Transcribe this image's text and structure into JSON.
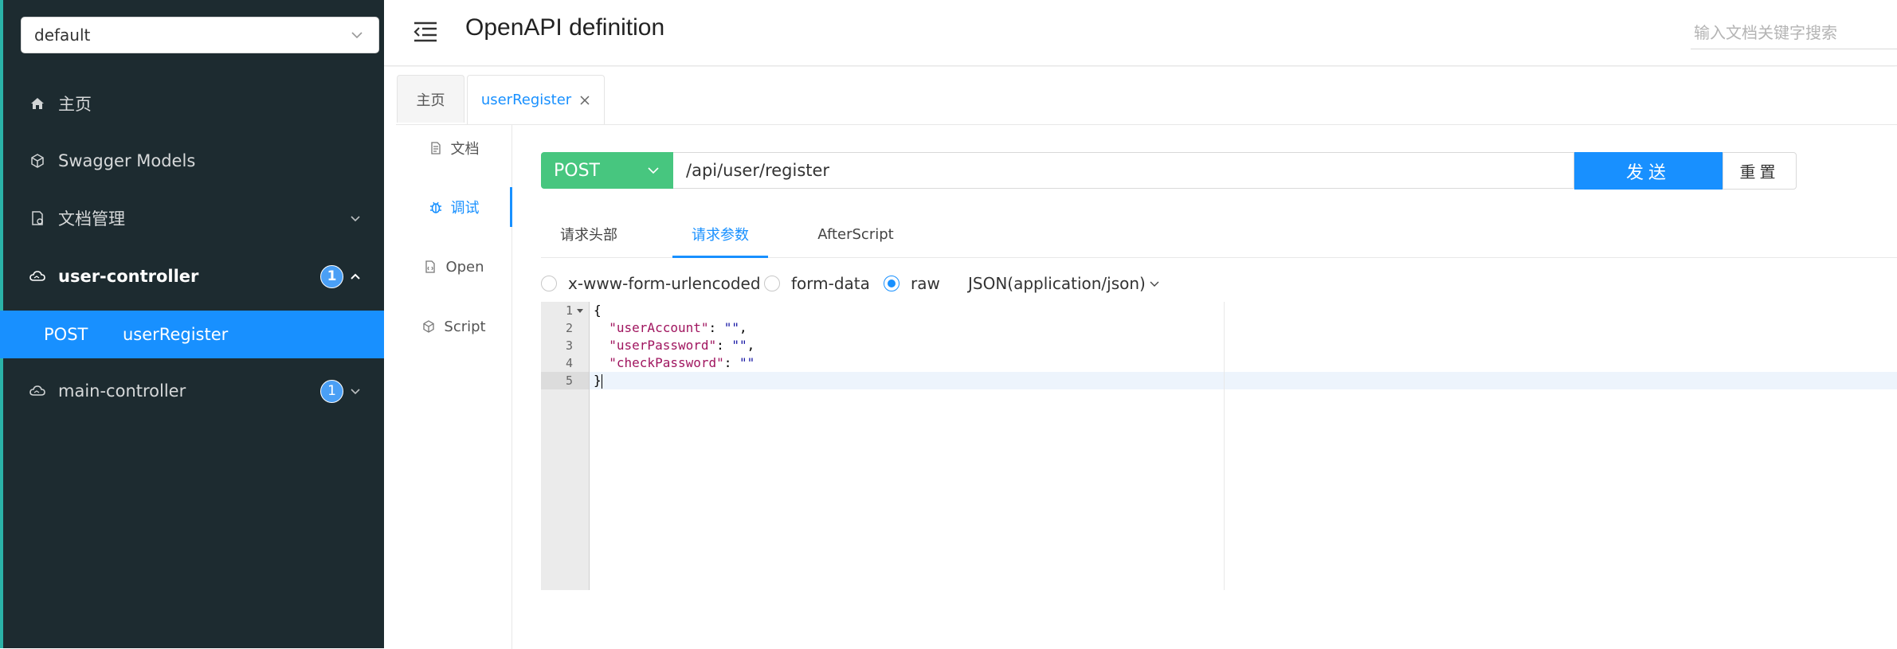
{
  "sidebar": {
    "group_select": "default",
    "items": [
      {
        "label": "主页",
        "icon": "home-icon"
      },
      {
        "label": "Swagger Models",
        "icon": "models-icon"
      },
      {
        "label": "文档管理",
        "icon": "document-manage-icon"
      },
      {
        "label": "user-controller",
        "icon": "cloud-icon",
        "badge": "1"
      },
      {
        "label": "main-controller",
        "icon": "cloud-icon",
        "badge": "1"
      }
    ],
    "active_api": {
      "method": "POST",
      "name": "userRegister"
    }
  },
  "header": {
    "title": "OpenAPI definition",
    "search_placeholder": "输入文档关键字搜索"
  },
  "tabs": [
    {
      "label": "主页"
    },
    {
      "label": "userRegister"
    }
  ],
  "side_tabs": [
    {
      "label": "文档"
    },
    {
      "label": "调试"
    },
    {
      "label": "Open"
    },
    {
      "label": "Script"
    }
  ],
  "request": {
    "method": "POST",
    "url": "/api/user/register",
    "send_label": "发送",
    "reset_label": "重置",
    "method_color": "#47c67f",
    "accent_color": "#1890ff"
  },
  "sub_tabs": [
    {
      "label": "请求头部"
    },
    {
      "label": "请求参数"
    },
    {
      "label": "AfterScript"
    }
  ],
  "body_types": {
    "options": [
      "x-www-form-urlencoded",
      "form-data",
      "raw"
    ],
    "selected": "raw",
    "content_type": "JSON(application/json)"
  },
  "editor": {
    "line_numbers": [
      "1",
      "2",
      "3",
      "4",
      "5"
    ],
    "lines": [
      {
        "open": "{"
      },
      {
        "key": "\"userAccount\"",
        "sep": ": ",
        "value": "\"\"",
        "end": ","
      },
      {
        "key": "\"userPassword\"",
        "sep": ": ",
        "value": "\"\"",
        "end": ","
      },
      {
        "key": "\"checkPassword\"",
        "sep": ": ",
        "value": "\"\"",
        "end": ""
      },
      {
        "close": "}"
      }
    ]
  }
}
